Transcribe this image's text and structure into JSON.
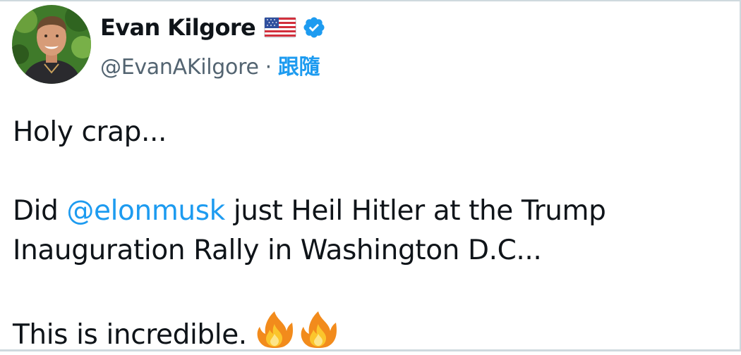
{
  "author": {
    "display_name": "Evan Kilgore",
    "handle": "@EvanAKilgore",
    "separator": "·",
    "follow_label": "跟隨",
    "flag_icon": "us-flag-icon",
    "verified_icon": "verified-badge-icon"
  },
  "tweet": {
    "line1": "Holy crap...",
    "line2_prefix": "Did ",
    "mention": "@elonmusk",
    "line2_suffix": " just Heil Hitler at the Trump",
    "line3": "Inauguration Rally in Washington D.C...",
    "line4": "This is incredible.",
    "emoji_icons": [
      "fire-icon",
      "fire-icon"
    ]
  },
  "colors": {
    "link": "#1d9bf0",
    "text": "#0f1419",
    "secondary": "#536471"
  }
}
